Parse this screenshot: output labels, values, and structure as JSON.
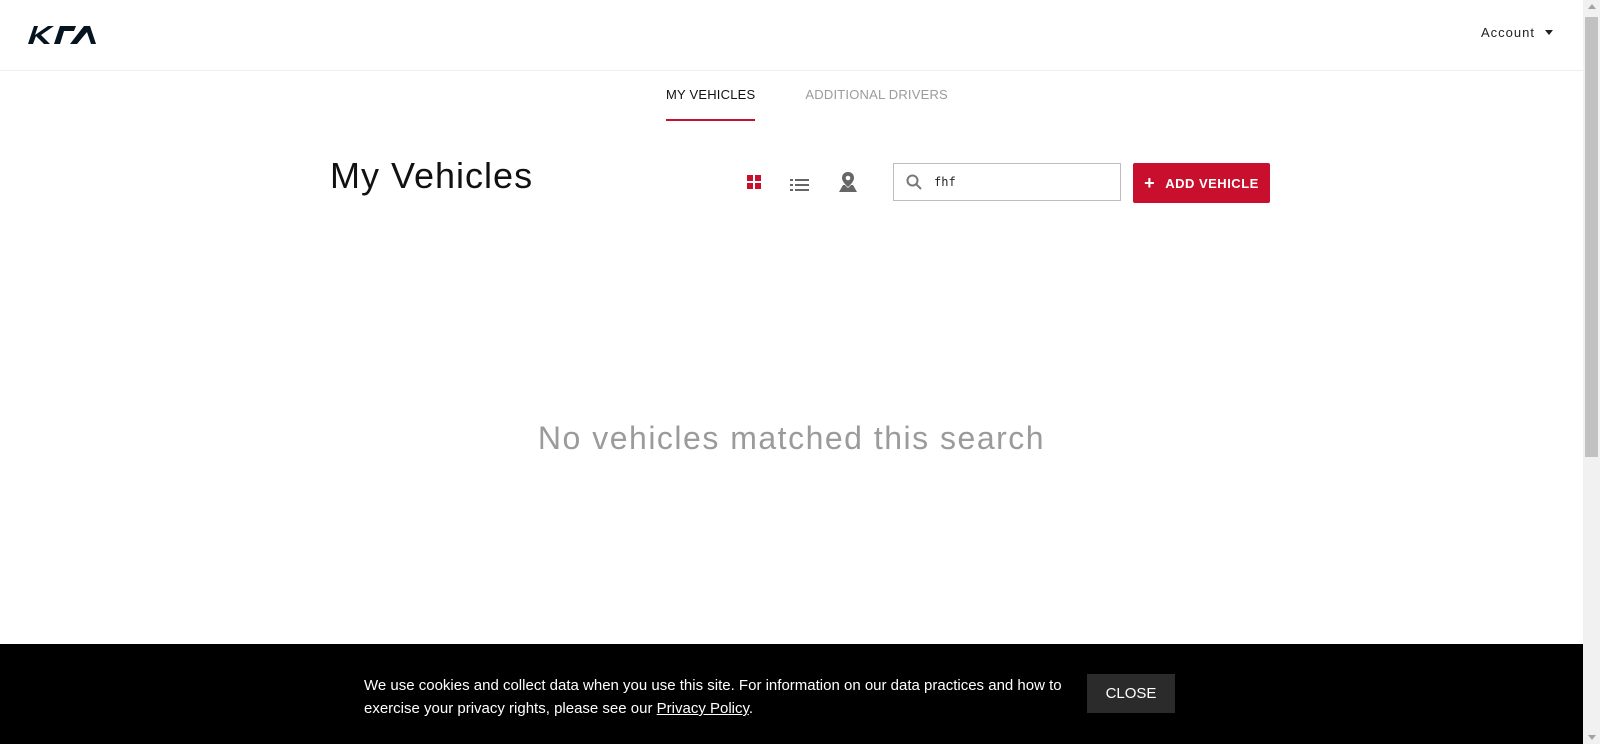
{
  "header": {
    "logo_text": "KIA",
    "account_label": "Account"
  },
  "tabs": [
    {
      "label": "MY VEHICLES",
      "active": true
    },
    {
      "label": "ADDITIONAL DRIVERS",
      "active": false
    }
  ],
  "main": {
    "title": "My Vehicles",
    "view_options": [
      {
        "icon": "grid-view-icon",
        "active": true
      },
      {
        "icon": "list-view-icon",
        "active": false
      },
      {
        "icon": "map-pin-icon",
        "active": false
      }
    ],
    "search": {
      "value": "fhf",
      "icon": "search-icon"
    },
    "add_button": {
      "label": "ADD VEHICLE",
      "icon": "plus-icon"
    },
    "empty_message": "No vehicles matched this search"
  },
  "cookie_banner": {
    "text_before_link": "We use cookies and collect data when you use this site. For information on our data practices and how to exercise your privacy rights, please see our ",
    "link_text": "Privacy Policy",
    "text_after_link": ".",
    "close_label": "CLOSE"
  },
  "colors": {
    "accent": "#c8102e",
    "inactive_text": "#9b9b9b",
    "banner_bg": "#000000",
    "close_bg": "#2b2b2b"
  }
}
